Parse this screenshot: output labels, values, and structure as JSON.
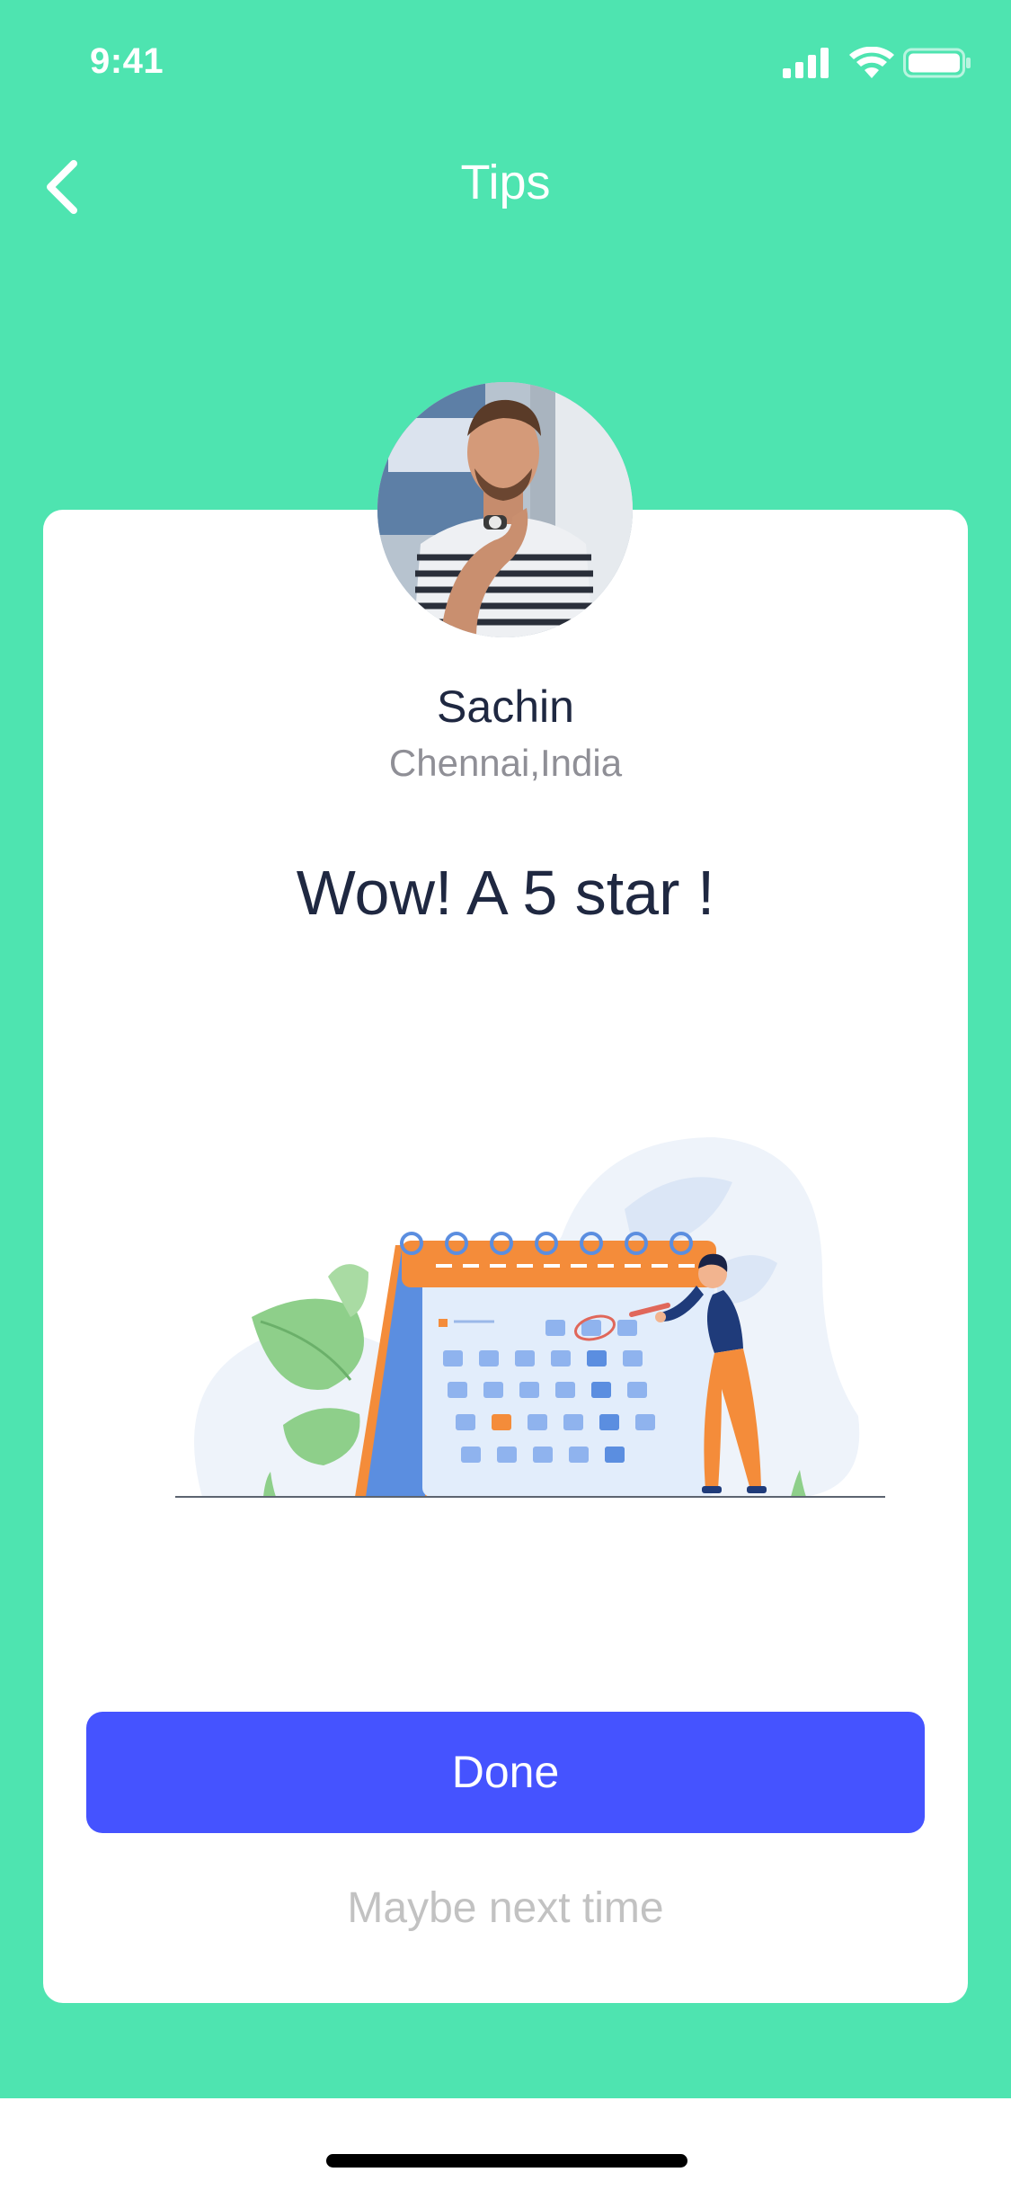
{
  "status_bar": {
    "time": "9:41",
    "icons": [
      "cellular-signal-icon",
      "wifi-icon",
      "battery-icon"
    ]
  },
  "nav": {
    "title": "Tips",
    "back_icon": "chevron-left-icon"
  },
  "user": {
    "name": "Sachin",
    "location": "Chennai,India"
  },
  "headline": "Wow! A 5 star !",
  "illustration": {
    "description": "",
    "icons": [
      "calendar-icon",
      "person-icon",
      "leaf-icon"
    ]
  },
  "actions": {
    "primary_label": "Done",
    "secondary_label": "Maybe next time"
  },
  "colors": {
    "background": "#4EE4B0",
    "card": "#FFFFFF",
    "primary_button": "#4553FF",
    "title_text": "#1F2841",
    "muted_text": "#8F8F96",
    "link_text": "#C2C2C2",
    "calendar_accent": "#F48C3A",
    "calendar_blue": "#5B8EE0"
  }
}
